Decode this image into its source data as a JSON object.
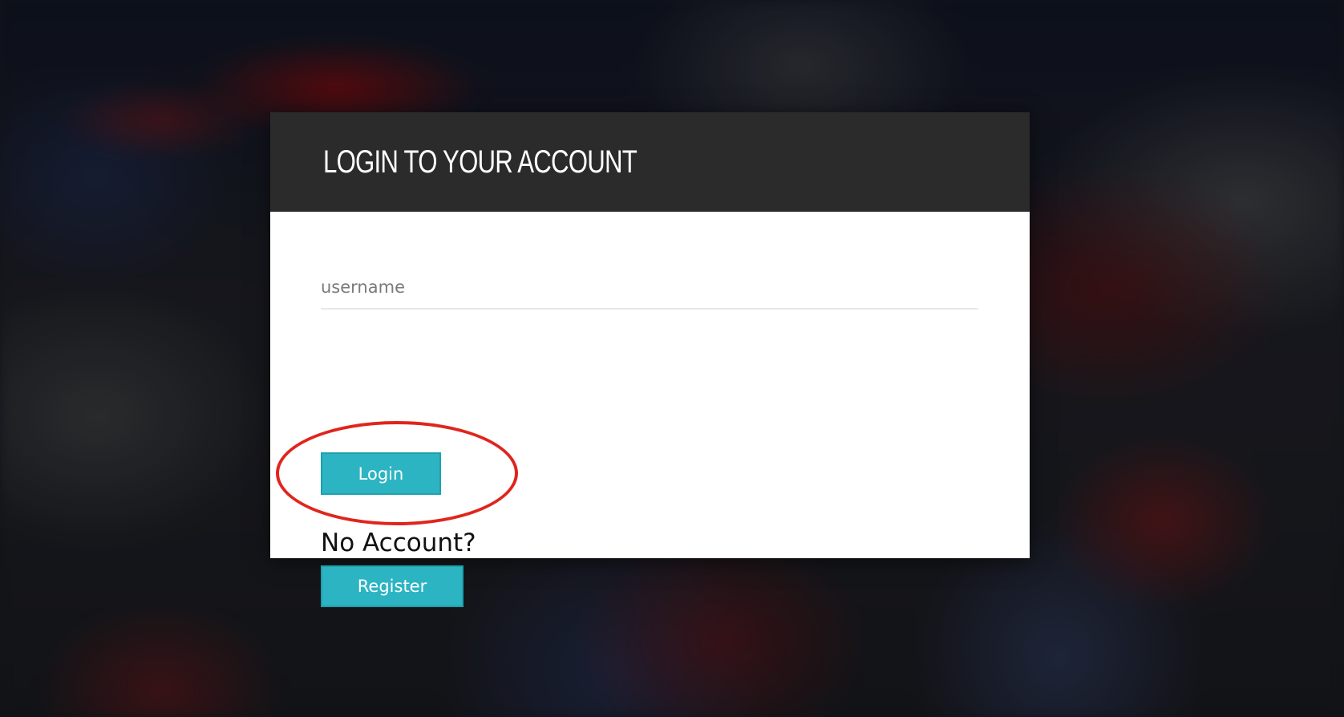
{
  "dialog": {
    "title": "LOGIN TO YOUR ACCOUNT"
  },
  "form": {
    "username_placeholder": "username",
    "username_value": "",
    "login_label": "Login",
    "no_account_text": "No Account?",
    "register_label": "Register"
  },
  "colors": {
    "header_bg": "#2b2b2b",
    "button_bg": "#2db4c3",
    "highlight": "#e0251c"
  }
}
